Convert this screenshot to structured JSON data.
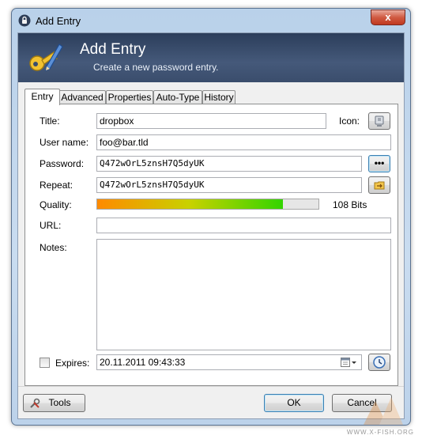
{
  "window": {
    "title": "Add Entry",
    "close_glyph": "x"
  },
  "banner": {
    "title": "Add Entry",
    "subtitle": "Create a new password entry."
  },
  "tabs": [
    {
      "label": "Entry"
    },
    {
      "label": "Advanced"
    },
    {
      "label": "Properties"
    },
    {
      "label": "Auto-Type"
    },
    {
      "label": "History"
    }
  ],
  "form": {
    "title_label": "Title:",
    "title_value": "dropbox",
    "icon_label": "Icon:",
    "username_label": "User name:",
    "username_value": "foo@bar.tld",
    "password_label": "Password:",
    "password_value": "Q472wOrL5znsH7Q5dyUK",
    "reveal_glyph": "•••",
    "repeat_label": "Repeat:",
    "repeat_value": "Q472wOrL5znsH7Q5dyUK",
    "quality_label": "Quality:",
    "quality_percent": 84,
    "quality_text": "108 Bits",
    "url_label": "URL:",
    "url_value": "",
    "notes_label": "Notes:",
    "notes_value": "",
    "expires_label": "Expires:",
    "expires_checked": false,
    "expires_value": "20.11.2011 09:43:33"
  },
  "buttons": {
    "tools": "Tools",
    "ok": "OK",
    "cancel": "Cancel"
  },
  "watermark": {
    "text": "WWW.X-FISH.ORG"
  },
  "colors": {
    "banner": "#3a4d6c",
    "quality_start": "#ff8a00",
    "quality_end": "#33d400",
    "focus": "#3c7fb1"
  },
  "icons": [
    "lock-icon",
    "key-pen-icon",
    "entry-icon",
    "generate-password-icon",
    "calendar-icon",
    "clock-icon",
    "tools-icon"
  ]
}
